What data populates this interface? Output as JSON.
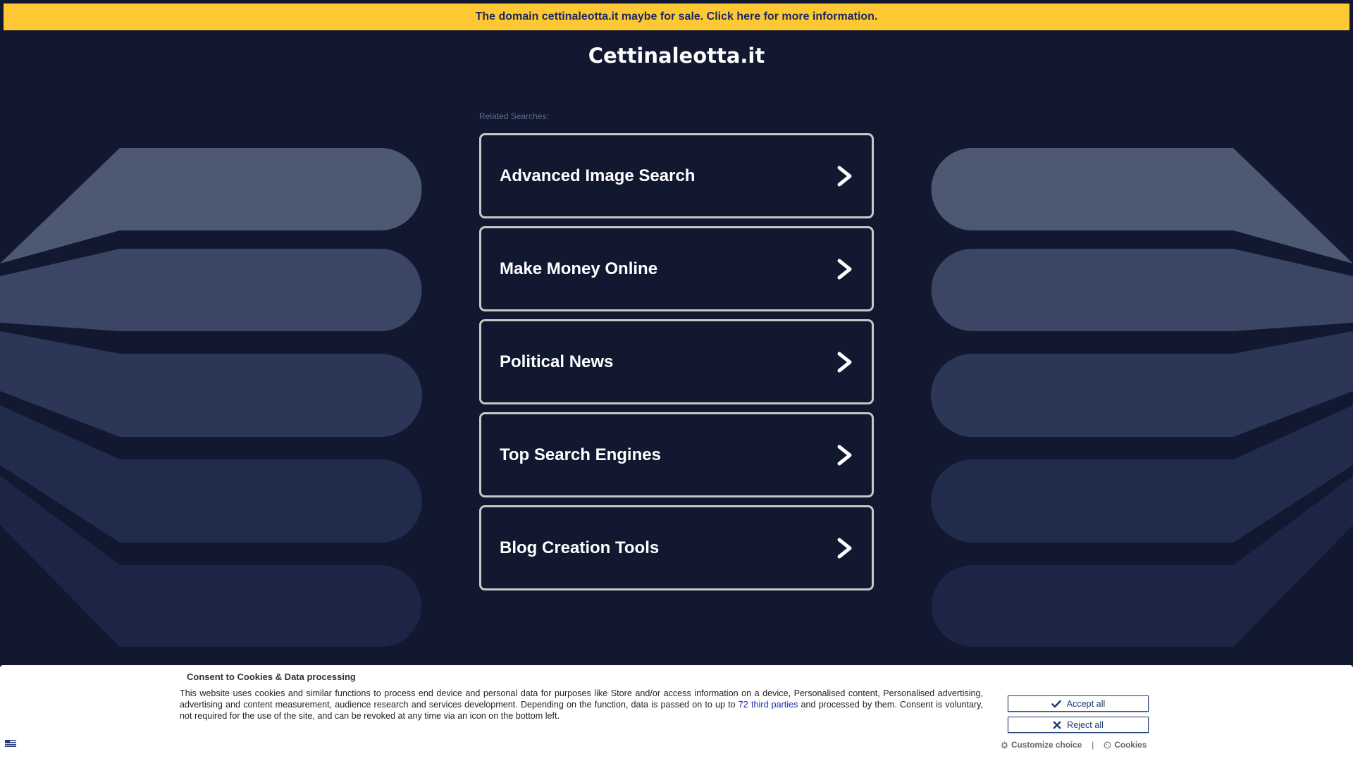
{
  "banner": {
    "text": "The domain cettinaleotta.it maybe for sale. Click here for more information."
  },
  "site": {
    "title": "Cettinaleotta.it"
  },
  "related": {
    "label": "Related Searches:",
    "items": [
      {
        "label": "Advanced Image Search"
      },
      {
        "label": "Make Money Online"
      },
      {
        "label": "Political News"
      },
      {
        "label": "Top Search Engines"
      },
      {
        "label": "Blog Creation Tools"
      }
    ]
  },
  "consent": {
    "title": "Consent to Cookies & Data processing",
    "text_before_link": "This website uses cookies and similar functions to process end device and personal data for purposes like Store and/or access information on a device, Personalised content, Personalised advertising, advertising and content measurement, audience research and services development. Depending on the function, data is passed on to up to ",
    "link_text": "72 third parties",
    "text_after_link": " and processed by them. Consent is voluntary, not required for the use of the site, and can be revoked at any time via an icon on the bottom left.",
    "accept_label": "Accept all",
    "reject_label": "Reject all",
    "customize_label": "Customize choice",
    "separator": "|",
    "cookies_label": "Cookies"
  },
  "icons": {
    "chevron": "chevron-right-icon",
    "accept": "check-icon",
    "reject": "close-icon",
    "customize": "gear-icon",
    "cookies": "cookie-icon",
    "language": "flag-icon"
  },
  "colors": {
    "banner_bg": "#fec834",
    "banner_text": "#1c2a5e",
    "page_bg": "#111830",
    "item_border": "#c8c8c8",
    "button_border": "#1c3c75",
    "link": "#1a2da6"
  }
}
